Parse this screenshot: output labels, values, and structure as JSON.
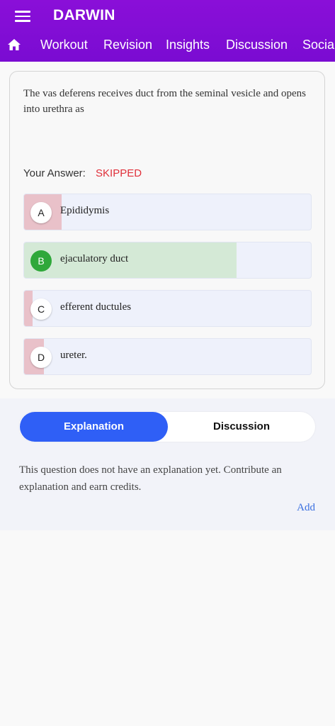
{
  "app": {
    "title": "DARWIN"
  },
  "nav": {
    "tabs": [
      "Workout",
      "Revision",
      "Insights",
      "Discussion",
      "Social"
    ]
  },
  "question": {
    "text": "The vas deferens receives duct from the seminal vesicle and opens into urethra as",
    "your_answer_label": "Your Answer:",
    "your_answer_value": "SKIPPED",
    "options": [
      {
        "letter": "A",
        "text": "Epididymis",
        "response_share": 0.13,
        "status": "wrong"
      },
      {
        "letter": "B",
        "text": "ejaculatory duct",
        "response_share": 0.74,
        "status": "correct"
      },
      {
        "letter": "C",
        "text": "efferent ductules",
        "response_share": 0.03,
        "status": "wrong"
      },
      {
        "letter": "D",
        "text": "ureter.",
        "response_share": 0.07,
        "status": "wrong"
      }
    ]
  },
  "explanation_section": {
    "tabs": [
      "Explanation",
      "Discussion"
    ],
    "active_tab": "Explanation",
    "message": "This question does not have an explanation yet. Contribute an explanation and earn credits.",
    "add_label": "Add"
  },
  "colors": {
    "appbar": "#8a0fd8",
    "skipped": "#e0303a",
    "correct": "#2fa83a",
    "wrong_fill": "#e9c1c9",
    "correct_fill": "#d4e9d6",
    "active_tab": "#2f5ff6",
    "link": "#3a6fe0"
  }
}
